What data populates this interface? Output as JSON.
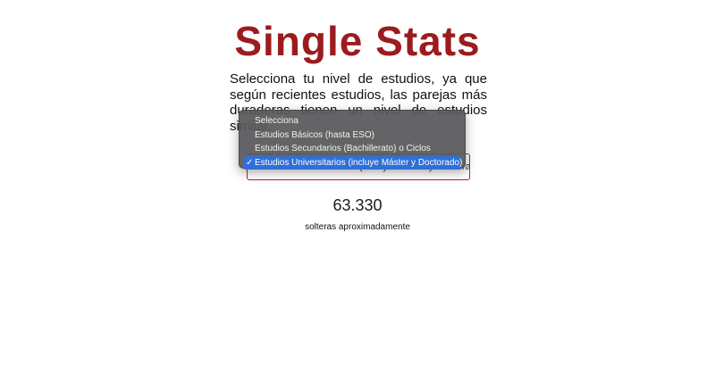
{
  "header": {
    "title": "Single Stats",
    "title_color": "#9b1b1e"
  },
  "intro": {
    "text": "Selecciona tu nivel de estudios, ya que según recientes estudios, las parejas más duraderas tienen un nivel de estudios similar."
  },
  "education_select": {
    "selected_value": "Estudios Universitarios (incluye Máster y Doctorado)",
    "border_color": "#b3262b",
    "options": [
      {
        "label": "Selecciona",
        "selected": false
      },
      {
        "label": "Estudios Básicos (hasta ESO)",
        "selected": false
      },
      {
        "label": "Estudios Secundarios (Bachillerato) o Ciclos",
        "selected": false
      },
      {
        "label": "Estudios Universitarios (incluye Máster y Doctorado)",
        "selected": true
      }
    ],
    "check_glyph": "✓",
    "highlight_color": "#2f6fd6"
  },
  "result": {
    "count": "63.330",
    "caption": "solteras aproximadamente"
  }
}
